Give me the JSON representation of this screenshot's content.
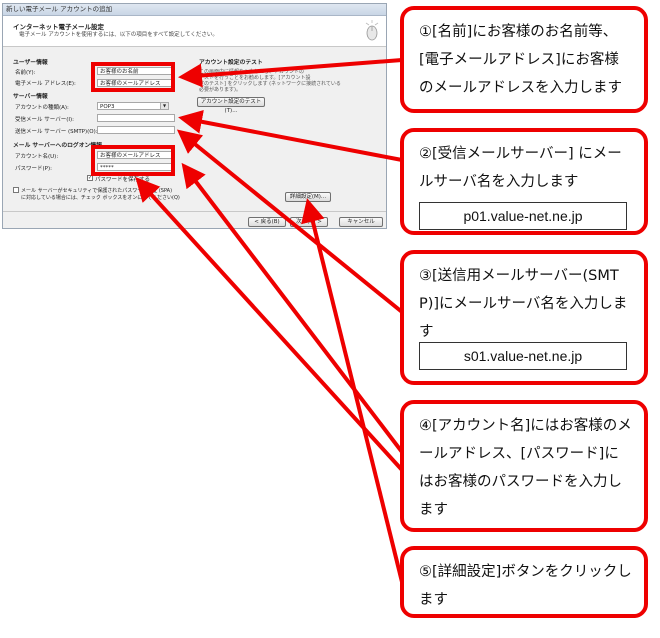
{
  "dialog": {
    "window_title": "新しい電子メール アカウントの追加",
    "header_title": "インターネット電子メール設定",
    "header_subtitle": "電子メール アカウントを使用するには、以下の項目をすべて設定してください。",
    "user_info_heading": "ユーザー情報",
    "name_label": "名前(Y):",
    "name_value": "お客様のお名前",
    "email_label": "電子メール アドレス(E):",
    "email_value": "お客様のメールアドレス",
    "server_info_heading": "サーバー情報",
    "account_type_label": "アカウントの種類(A):",
    "account_type_value": "POP3",
    "incoming_label": "受信メール サーバー(I):",
    "outgoing_label": "送信メール サーバー (SMTP)(O):",
    "logon_heading": "メール サーバーへのログオン情報",
    "account_name_label": "アカウント名(U):",
    "account_name_value": "お客様のメールアドレス",
    "password_label": "パスワード(P):",
    "password_value": "*****",
    "remember_password_label": "パスワードを保存する",
    "spa_label_line1": "メール サーバーがセキュリティで保護されたパスワード認証 (SPA)",
    "spa_label_line2": "に対応している場合には、チェック ボックスをオンにしてください(Q)",
    "test_heading": "アカウント設定のテスト",
    "test_info_line1": "この画面内に情報を入力したら、アカウントの",
    "test_info_line2": "テストを行うことをお勧めします。[アカウント設",
    "test_info_line3": "定のテスト] をクリックします (ネットワークに接続されている",
    "test_info_line4": "必要があります)。",
    "test_button": "アカウント設定のテスト(T)...",
    "more_settings_button": "詳細設定(M)...",
    "back_button": "< 戻る(B)",
    "next_button": "次へ(N) >",
    "cancel_button": "キャンセル"
  },
  "callouts": [
    {
      "id": "1",
      "text": "①[名前]にお客様のお名前等、[電子メールアドレス]にお客様のメールアドレスを入力します"
    },
    {
      "id": "2",
      "text": "②[受信メールサーバー] にメールサーバ名を入力します",
      "server": "p01.value-net.ne.jp"
    },
    {
      "id": "3",
      "text": "③[送信用メールサーバー(SMTP)]にメールサーバ名を入力します",
      "server": "s01.value-net.ne.jp"
    },
    {
      "id": "4",
      "text": "④[アカウント名]にはお客様のメールアドレス、[パスワード]にはお客様のパスワードを入力します"
    },
    {
      "id": "5",
      "text": "⑤[詳細設定]ボタンをクリックします"
    }
  ],
  "colors": {
    "highlight": "#ee0000",
    "dialog_bg": "#f0f0f0"
  },
  "icons": [
    "mouse-icon",
    "dropdown-arrow-icon",
    "checkbox-icon"
  ]
}
